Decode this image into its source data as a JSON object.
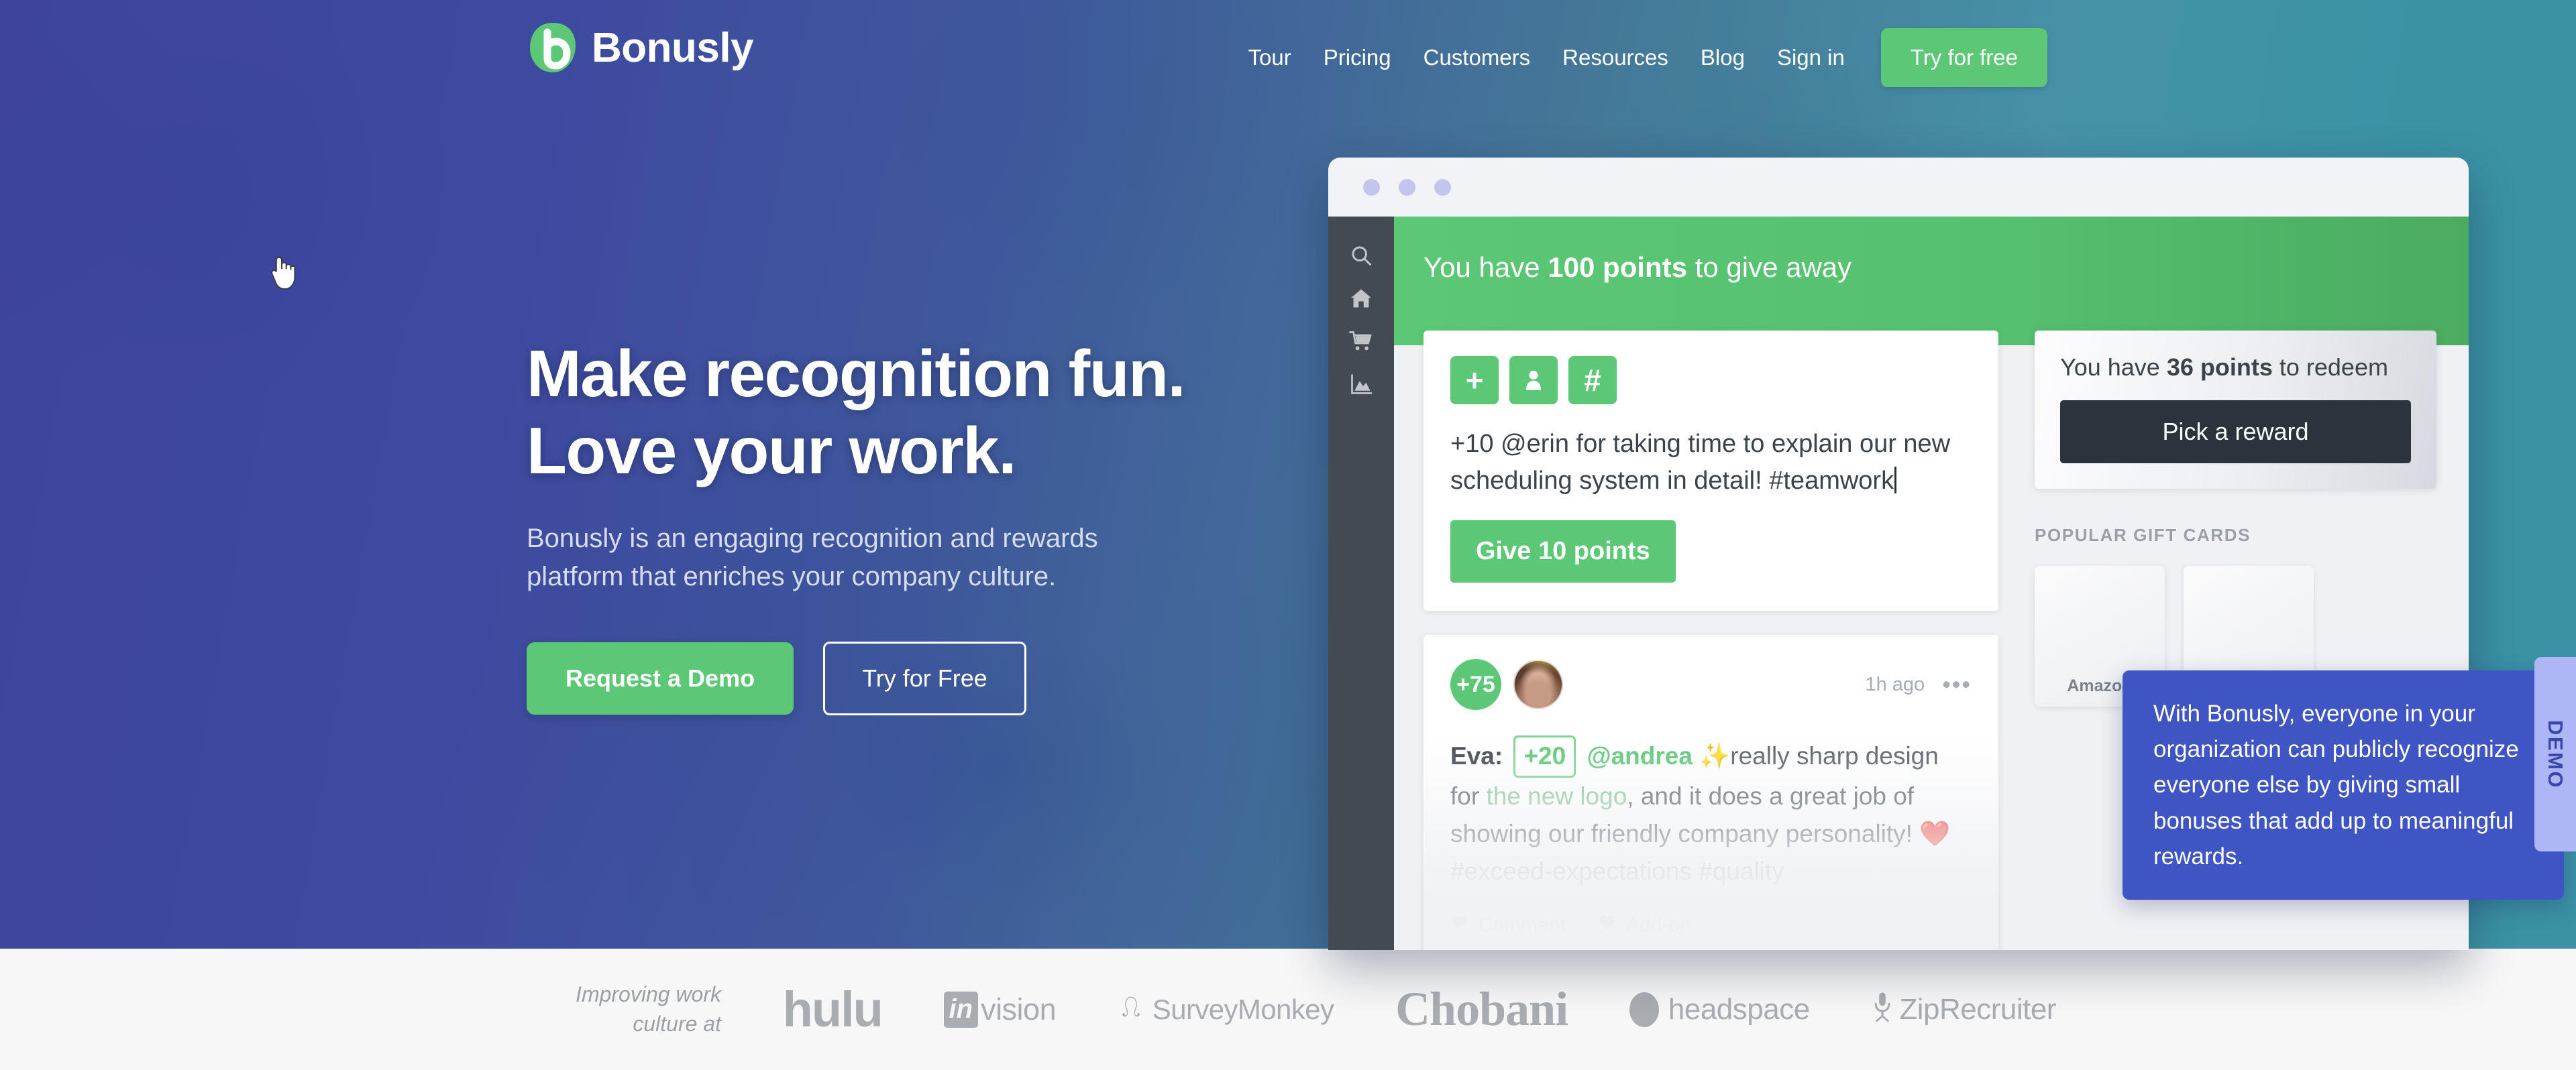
{
  "brand": {
    "name": "Bonusly",
    "logo_icon": "bonusly-leaf-logo",
    "logo_color": "#5cc876"
  },
  "nav": {
    "links": [
      {
        "label": "Tour"
      },
      {
        "label": "Pricing"
      },
      {
        "label": "Customers"
      },
      {
        "label": "Resources"
      },
      {
        "label": "Blog"
      },
      {
        "label": "Sign in"
      }
    ],
    "cta_label": "Try for free"
  },
  "hero": {
    "heading_line1": "Make recognition fun.",
    "heading_line2": "Love your work.",
    "subheading": "Bonusly is an engaging recognition and rewards platform that enriches your company culture.",
    "primary_button": "Request a Demo",
    "secondary_button": "Try for Free",
    "overlay_color": "#2f3696",
    "accent_teal": "#3b92a5"
  },
  "app": {
    "chrome_dots": 3,
    "sidebar_icons": [
      "search-icon",
      "home-icon",
      "cart-icon",
      "chart-icon"
    ],
    "banner": {
      "prefix": "You have ",
      "highlight": "100 points",
      "suffix": " to give away"
    },
    "composer": {
      "icon_buttons": [
        "plus-icon",
        "person-icon",
        "hash-icon"
      ],
      "value": "+10 @erin for taking time to explain our new scheduling system in detail! #teamwork",
      "submit_label": "Give 10 points"
    },
    "post": {
      "points_badge": "+75",
      "avatar": "user-avatar",
      "time": "1h ago",
      "menu_icon": "ellipsis-icon",
      "author": "Eva:",
      "amount": "+20",
      "mention": "@andrea",
      "sparkle": "✨",
      "text1": "really sharp design for ",
      "link": "the new logo",
      "text2": ", and it does a great job of showing our friendly company personality! ",
      "heart": "❤️",
      "hashtags": "#exceed-expectations #quality",
      "actions": [
        {
          "label": "Comment",
          "icon": "comment-icon"
        },
        {
          "label": "Add-on",
          "icon": "heart-icon"
        }
      ]
    },
    "redeem": {
      "prefix": "You have ",
      "highlight": "36 points",
      "suffix": " to redeem",
      "button_label": "Pick a reward"
    },
    "gift_cards": {
      "heading": "POPULAR GIFT CARDS",
      "tiles": [
        {
          "label": "Amazon"
        },
        {
          "label": ""
        }
      ]
    }
  },
  "tooltip": {
    "text": "With Bonusly, everyone in your organization can publicly recognize everyone else by giving small bonuses that add up to meaningful rewards.",
    "color": "#4055c4"
  },
  "demo_tab": {
    "label": "DEMO",
    "color": "#aeb6f5"
  },
  "logobar": {
    "caption_line1": "Improving work",
    "caption_line2": "culture at",
    "logos": [
      {
        "name": "hulu",
        "text": "hulu"
      },
      {
        "name": "invision",
        "mark": "in",
        "text": "vision"
      },
      {
        "name": "surveymonkey",
        "text": "SurveyMonkey"
      },
      {
        "name": "chobani",
        "text": "Chobani"
      },
      {
        "name": "headspace",
        "text": "headspace"
      },
      {
        "name": "ziprecruiter",
        "text": "ZipRecruiter"
      }
    ]
  }
}
